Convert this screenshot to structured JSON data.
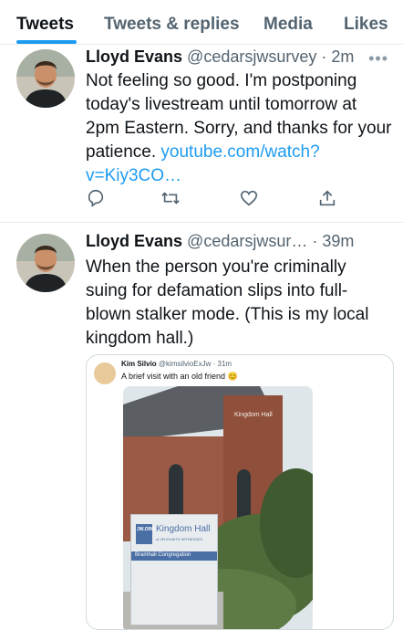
{
  "tabs": [
    {
      "label": "Tweets",
      "active": true
    },
    {
      "label": "Tweets & replies",
      "active": false
    },
    {
      "label": "Media",
      "active": false
    },
    {
      "label": "Likes",
      "active": false
    }
  ],
  "tweets": [
    {
      "name": "Lloyd Evans",
      "handle": "@cedarsjwsurvey",
      "time": "2m",
      "text": "Not feeling so good. I'm postponing today's livestream until tomorrow at 2pm Eastern. Sorry, and thanks for your patience.",
      "link": "youtube.com/watch?v=Kiy3CO…",
      "actions": [
        "reply-icon",
        "retweet-icon",
        "like-icon",
        "share-icon"
      ]
    },
    {
      "name": "Lloyd Evans",
      "handle": "@cedarsjwsur…",
      "time": "39m",
      "text": "When the person you're criminally suing for defamation slips into full-blown stalker mode. (This is my local kingdom hall.)",
      "quote": {
        "name": "Kim Silvio",
        "handle": "@kimsilvioExJw",
        "time": "31m",
        "text": "A brief visit with an old friend",
        "emoji": "😊",
        "image": {
          "sign_logo": "JW.ORG",
          "sign_title": "Kingdom Hall",
          "sign_subtitle": "of JEHOVAH'S WITNESSES",
          "sign_location": "Bramhall Congregation",
          "wall_title": "Kingdom Hall"
        }
      }
    }
  ],
  "colors": {
    "accent": "#1d9bf0",
    "secondary_text": "#536471",
    "divider": "#e6ecf0"
  }
}
